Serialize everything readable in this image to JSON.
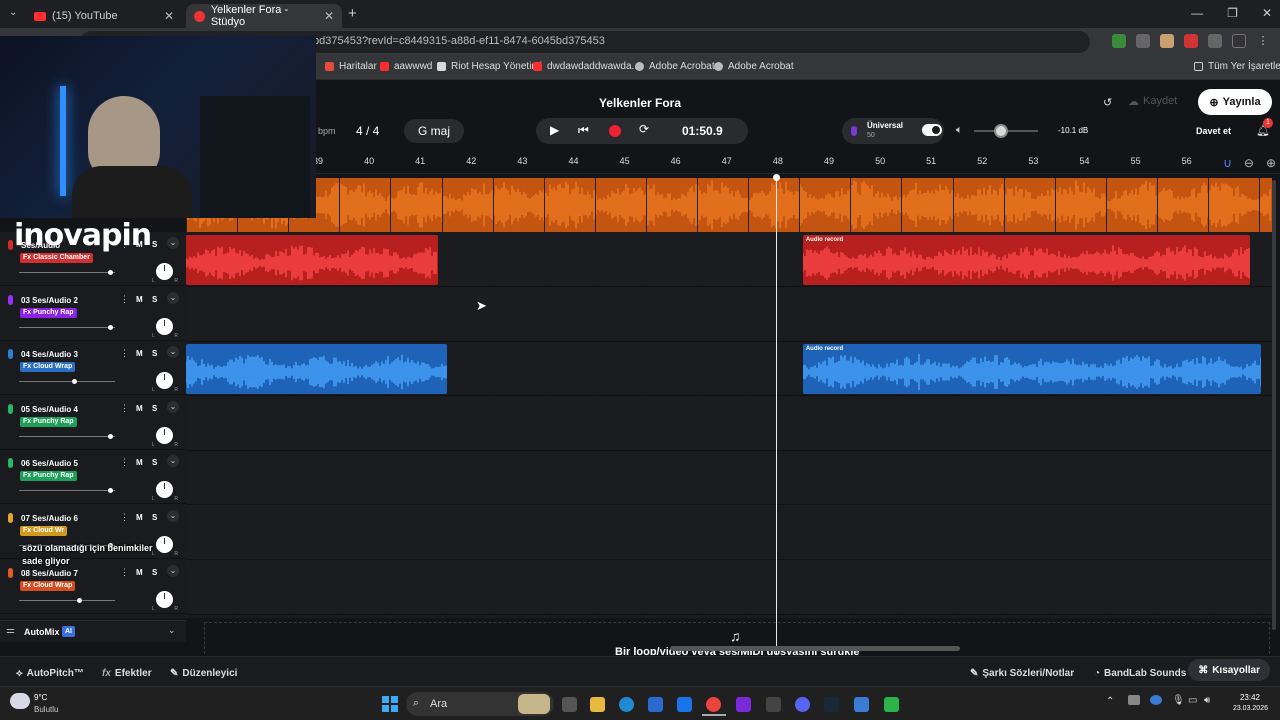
{
  "browser": {
    "tabs": [
      {
        "label": "(15) YouTube"
      },
      {
        "label": "Yelkenler Fora - Stüdyo"
      }
    ],
    "url": "bd375453?revId=c8449315-a88d-ef11-8474-6045bd375453",
    "bookmarks": [
      {
        "label": "Haritalar",
        "color": "#e34a3a"
      },
      {
        "label": "aawwwd",
        "color": "#ff2d2d"
      },
      {
        "label": "Riot Hesap Yönetimi",
        "color": "#d8d8d8"
      },
      {
        "label": "dwdawdaddwawda...",
        "color": "#ff2d2d"
      },
      {
        "label": "Adobe Acrobat",
        "color": "#bbbbbb"
      },
      {
        "label": "Adobe Acrobat",
        "color": "#bbbbbb"
      }
    ],
    "all_bookmarks": "Tüm Yer İşaretleri"
  },
  "studio": {
    "title": "Yelkenler Fora",
    "save_label": "Kaydet",
    "publish_label": "Yayınla",
    "bpm_label": "bpm",
    "time_signature": "4 / 4",
    "key": "G maj",
    "timecode": "01:50.9",
    "universal_label": "Üniversal",
    "universal_value": "50",
    "volume": "-10.1 dB",
    "invite_label": "Davet et",
    "notifications_count": "1"
  },
  "ruler": {
    "bars": [
      "39",
      "40",
      "41",
      "42",
      "43",
      "44",
      "45",
      "46",
      "47",
      "48",
      "49",
      "50",
      "51",
      "52",
      "53",
      "54",
      "55",
      "56"
    ]
  },
  "tracks": [
    {
      "title": "Ses/Audio",
      "fx": "Fx Classic Chamber",
      "color": "#d02a2a",
      "fx_color": "#d03030",
      "volume": 0.96,
      "clips": [
        {
          "label": "",
          "start": 0,
          "end": 0.232
        },
        {
          "label": "Audio record",
          "start": 0.568,
          "end": 0.98
        }
      ]
    },
    {
      "title": "03  Ses/Audio 2",
      "fx": "Fx Punchy Rap",
      "color": "#9b2cff",
      "fx_color": "#8a23e6",
      "volume": 0.96,
      "clips": []
    },
    {
      "title": "04  Ses/Audio 3",
      "fx": "Fx Cloud Wrap",
      "color": "#2f7fd6",
      "fx_color": "#2a6fc4",
      "volume": 0.58,
      "clips": [
        {
          "label": "",
          "start": 0,
          "end": 0.24
        },
        {
          "label": "Audio record",
          "start": 0.568,
          "end": 0.99
        }
      ]
    },
    {
      "title": "05  Ses/Audio 4",
      "fx": "Fx Punchy Rap",
      "color": "#22b866",
      "fx_color": "#1fa05a",
      "volume": 0.96,
      "clips": []
    },
    {
      "title": "06  Ses/Audio 5",
      "fx": "Fx Punchy Rap",
      "color": "#22b866",
      "fx_color": "#1fa05a",
      "volume": 0.96,
      "clips": []
    },
    {
      "title": "07  Ses/Audio 6",
      "fx": "Fx Cloud Wr",
      "color": "#e0a528",
      "fx_color": "#d19a1f",
      "volume": 0.96,
      "clips": []
    },
    {
      "title": "08  Ses/Audio 7",
      "fx": "Fx Cloud Wrap",
      "color": "#e05a28",
      "fx_color": "#d04e1f",
      "volume": 0.64,
      "clips": []
    }
  ],
  "mute_label": "M",
  "solo_label": "S",
  "automix": {
    "label": "AutoMix",
    "badge": "AI"
  },
  "drop_hint": "Bir loop/video veya ses/MIDI dosyasını sürükleyin",
  "bottom_bar": {
    "autopitch": "AutoPitch™",
    "effects": "Efektler",
    "editor": "Düzenleyici",
    "lyrics": "Şarkı Sözleri/Notlar",
    "sounds": "BandLab Sounds",
    "shortcuts": "Kısayollar"
  },
  "overlay": {
    "logo": "inovapin",
    "caption": "sözü olamadığı için benimkiler sade gliyor"
  },
  "taskbar": {
    "weather_temp": "9°C",
    "weather_desc": "Bulutlu",
    "search": "Ara",
    "time": "23:42",
    "date": "23.03.2026"
  }
}
